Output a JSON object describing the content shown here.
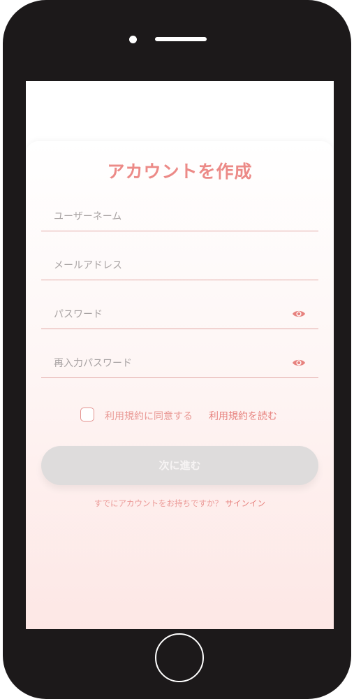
{
  "screen": {
    "title": "アカウントを作成"
  },
  "form": {
    "username": {
      "placeholder": "ユーザーネーム",
      "value": ""
    },
    "email": {
      "placeholder": "メールアドレス",
      "value": ""
    },
    "password": {
      "placeholder": "パスワード",
      "value": ""
    },
    "password_confirm": {
      "placeholder": "再入力パスワード",
      "value": ""
    }
  },
  "terms": {
    "agree_label": "利用規約に同意する",
    "read_link": "利用規約を読む",
    "checked": false
  },
  "next_button_label": "次に進む",
  "signin": {
    "prompt": "すでにアカウントをお持ちですか？",
    "link": "サインイン"
  },
  "colors": {
    "accent": "#ec8a87",
    "button_disabled": "#dedcdc",
    "phone_body": "#1c191a"
  },
  "icons": {
    "password_toggle": "eye-icon",
    "password_confirm_toggle": "eye-icon"
  }
}
